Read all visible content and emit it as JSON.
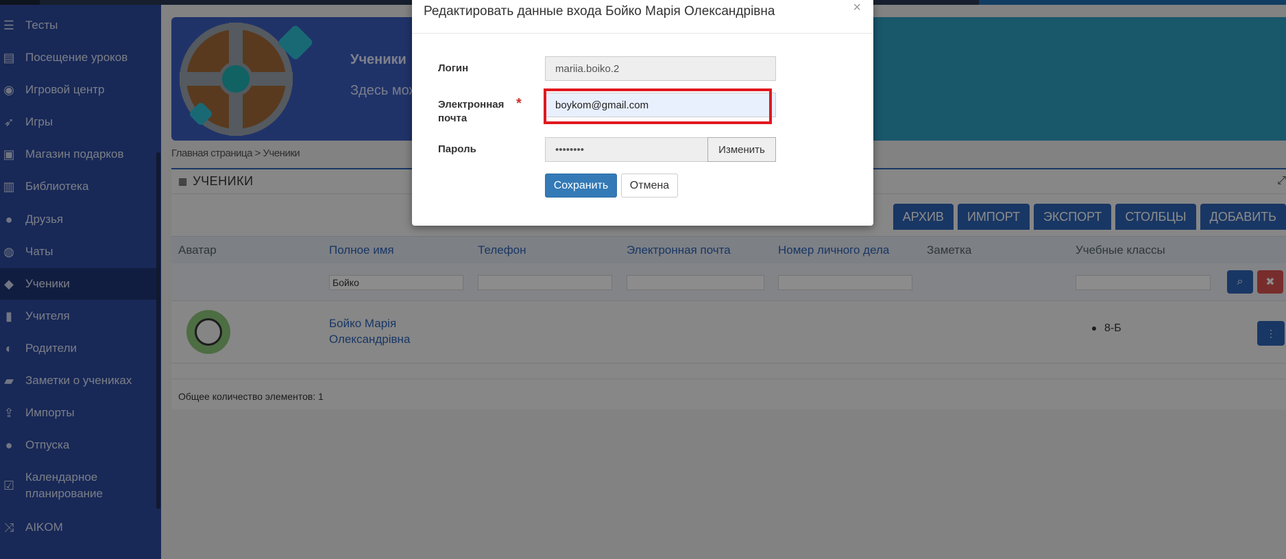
{
  "sidebar": {
    "items": [
      {
        "label": "Тесты",
        "icon": "list-icon"
      },
      {
        "label": "Посещение уроков",
        "icon": "document-icon"
      },
      {
        "label": "Игровой центр",
        "icon": "gamepad-icon"
      },
      {
        "label": "Игры",
        "icon": "rocket-icon"
      },
      {
        "label": "Магазин подарков",
        "icon": "gift-icon"
      },
      {
        "label": "Библиотека",
        "icon": "book-icon"
      },
      {
        "label": "Друзья",
        "icon": "users-icon"
      },
      {
        "label": "Чаты",
        "icon": "chat-icon"
      },
      {
        "label": "Ученики",
        "icon": "graduation-cap-icon"
      },
      {
        "label": "Учителя",
        "icon": "teacher-icon"
      },
      {
        "label": "Родители",
        "icon": "parent-icon"
      },
      {
        "label": "Заметки о учениках",
        "icon": "note-icon"
      },
      {
        "label": "Импорты",
        "icon": "upload-icon"
      },
      {
        "label": "Отпуска",
        "icon": "circle-icon"
      },
      {
        "label": "Календарное планирование",
        "icon": "calendar-check-icon"
      },
      {
        "label": "AIKOM",
        "icon": "shuffle-icon"
      }
    ],
    "active_index": 8
  },
  "banner": {
    "title": "Ученики",
    "subtitle": "Здесь мож"
  },
  "breadcrumb": "Главная страница > Ученики",
  "panel": {
    "title": "УЧЕНИКИ",
    "toolbar": {
      "archive": "АРХИВ",
      "import": "ИМПОРТ",
      "export": "ЭКСПОРТ",
      "columns": "СТОЛБЦЫ",
      "add": "ДОБАВИТЬ"
    },
    "columns": [
      "Аватар",
      "Полное имя",
      "Телефон",
      "Электронная почта",
      "Номер личного дела",
      "Заметка",
      "Учебные классы"
    ],
    "filters": {
      "full_name": "Бойко"
    },
    "rows": [
      {
        "name_line1": "Бойко Марія",
        "name_line2": "Олександрівна",
        "class": "8-Б"
      }
    ],
    "total": "Общее количество элементов: 1"
  },
  "modal": {
    "title": "Редактировать данные входа Бойко Марія Олександрівна",
    "close": "×",
    "login_label": "Логин",
    "login_value": "mariia.boiko.2",
    "email_label_1": "Электронная",
    "email_label_2": "почта",
    "required_mark": "*",
    "email_value": "boykom@gmail.com",
    "password_label": "Пароль",
    "password_value": "••••••••",
    "change_label": "Изменить",
    "save_label": "Сохранить",
    "cancel_label": "Отмена"
  },
  "colors": {
    "sidebar_bg": "#2c4a9e",
    "accent": "#2f64b6",
    "highlight": "#e0191f",
    "danger": "#d9534f"
  }
}
